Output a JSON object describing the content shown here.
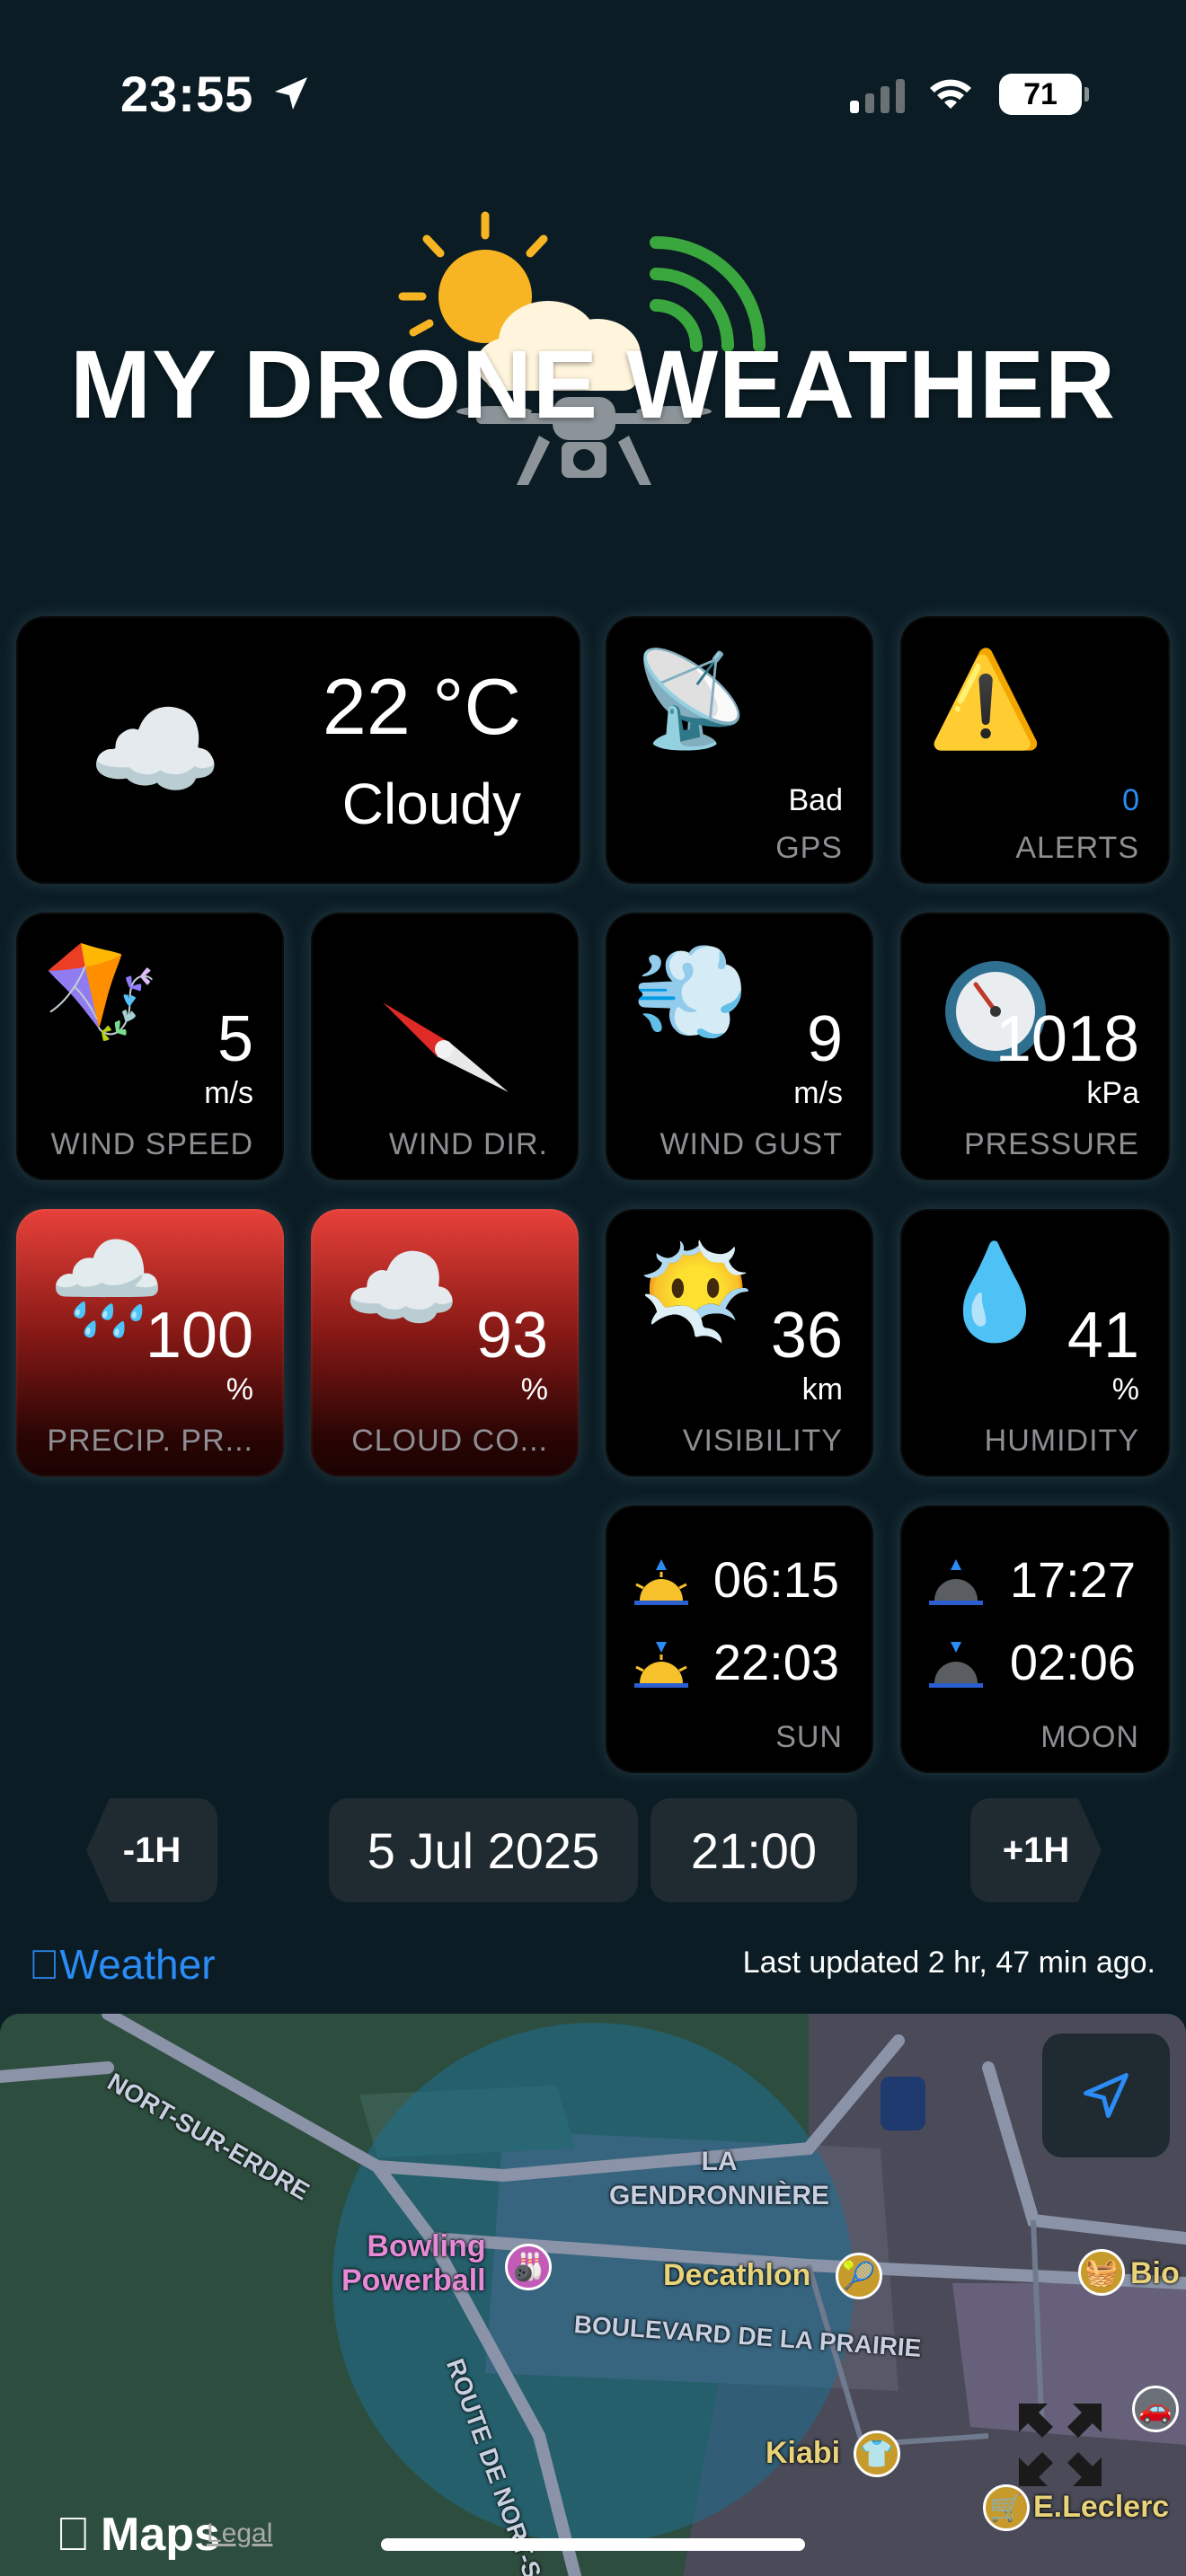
{
  "status_bar": {
    "time": "23:55",
    "battery": "71"
  },
  "header": {
    "title": "MY DRONE WEATHER"
  },
  "current": {
    "temp": "22 °C",
    "condition": "Cloudy",
    "icon": "cloud-icon"
  },
  "gps": {
    "value": "Bad",
    "label": "GPS",
    "icon": "satellite-dish-icon"
  },
  "alerts": {
    "value": "0",
    "label": "ALERTS",
    "icon": "warning-icon"
  },
  "wind_speed": {
    "value": "5",
    "unit": "m/s",
    "label": "WIND SPEED",
    "icon": "kite-icon"
  },
  "wind_dir": {
    "label": "WIND DIR.",
    "icon": "compass-needle-icon"
  },
  "wind_gust": {
    "value": "9",
    "unit": "m/s",
    "label": "WIND GUST",
    "icon": "wind-gust-icon"
  },
  "pressure": {
    "value": "1018",
    "unit": "kPa",
    "label": "PRESSURE",
    "icon": "gauge-icon"
  },
  "precip": {
    "value": "100",
    "unit": "%",
    "label": "PRECIP. PR...",
    "icon": "rain-cloud-icon"
  },
  "cloud_cover": {
    "value": "93",
    "unit": "%",
    "label": "CLOUD CO...",
    "icon": "cloud-icon"
  },
  "visibility": {
    "value": "36",
    "unit": "km",
    "label": "VISIBILITY",
    "icon": "fog-face-icon"
  },
  "humidity": {
    "value": "41",
    "unit": "%",
    "label": "HUMIDITY",
    "icon": "droplet-icon"
  },
  "sun": {
    "rise": "06:15",
    "set": "22:03",
    "label": "SUN"
  },
  "moon": {
    "rise": "17:27",
    "set": "02:06",
    "label": "MOON"
  },
  "nav": {
    "prev": "-1H",
    "date": "5 Jul 2025",
    "time": "21:00",
    "next": "+1H"
  },
  "footer": {
    "weather_brand": "Weather",
    "updated": "Last updated 2 hr, 47 min ago."
  },
  "map": {
    "road_north": "NORT-SUR-ERDRE",
    "area": "LA\nGENDRONNIÈRE",
    "bowling": "Bowling\nPowerball",
    "decathlon": "Decathlon",
    "bio": "Bio",
    "boulevard": "BOULEVARD DE LA PRAIRIE",
    "route": "ROUTE DE NORT-S",
    "kiabi": "Kiabi",
    "leclerc": "E.Leclerc",
    "maps_brand": "Maps",
    "legal": "Legal"
  },
  "colors": {
    "accent_blue": "#2b8cf5",
    "card_red": "#e8413a",
    "background": "#0b1c24"
  }
}
